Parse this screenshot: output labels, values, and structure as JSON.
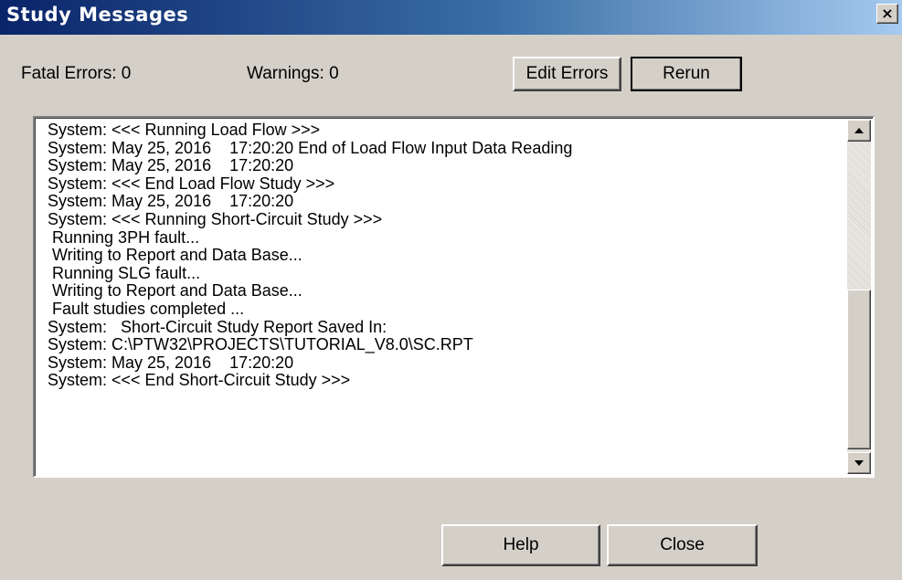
{
  "window": {
    "title": "Study Messages",
    "close_label": "×"
  },
  "summary": {
    "fatal_errors": "Fatal Errors:  0",
    "warnings": "Warnings:  0"
  },
  "buttons": {
    "edit_errors": "Edit Errors",
    "rerun": "Rerun",
    "help": "Help",
    "close": "Close"
  },
  "log": {
    "lines": [
      "System: <<< Running Load Flow >>>",
      "System: May 25, 2016    17:20:20 End of Load Flow Input Data Reading",
      "System: May 25, 2016    17:20:20",
      "System: <<< End Load Flow Study >>>",
      "System: May 25, 2016    17:20:20",
      "System: <<< Running Short-Circuit Study >>>",
      " Running 3PH fault...",
      " Writing to Report and Data Base...",
      " Running SLG fault...",
      " Writing to Report and Data Base...",
      " Fault studies completed ...",
      "System:   Short-Circuit Study Report Saved In:",
      "System: C:\\PTW32\\PROJECTS\\TUTORIAL_V8.0\\SC.RPT",
      "System: May 25, 2016    17:20:20",
      "System: <<< End Short-Circuit Study >>>"
    ]
  },
  "icons": {
    "scroll_up": "scroll-up-arrow-icon",
    "scroll_down": "scroll-down-arrow-icon",
    "close": "close-x-icon"
  }
}
